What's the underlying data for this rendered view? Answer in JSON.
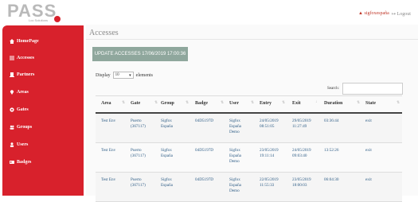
{
  "header": {
    "logo": "PASS",
    "logo_sub": "Loc Solutions",
    "user": "sigfoxespaña",
    "logout": "Logout"
  },
  "sidebar": {
    "items": [
      {
        "label": "HomePage",
        "icon": "home-icon"
      },
      {
        "label": "Accesses",
        "icon": "list-icon"
      },
      {
        "label": "Partners",
        "icon": "building-icon"
      },
      {
        "label": "Areas",
        "icon": "location-pin-icon"
      },
      {
        "label": "Gates",
        "icon": "gear-icon"
      },
      {
        "label": "Groups",
        "icon": "group-icon"
      },
      {
        "label": "Users",
        "icon": "user-icon"
      },
      {
        "label": "Badges",
        "icon": "id-card-icon"
      }
    ]
  },
  "main": {
    "title": "Accesses",
    "update_button": "UPDATE ACCESSES 17/06/2019 17:00:36",
    "display_label": "Display",
    "display_value": "10",
    "display_suffix": "elements",
    "search_label": "Search:"
  },
  "table": {
    "columns": [
      "Area",
      "Gate",
      "Group",
      "Badge",
      "User",
      "Entry",
      "Exit",
      "Duration",
      "State"
    ],
    "rows": [
      {
        "area": "Test Env",
        "gate": [
          "Puerto",
          "(367117)"
        ],
        "group": [
          "Sigfox",
          "España"
        ],
        "badge": "04D5197D",
        "user": [
          "Sigfox",
          "España",
          "Demo"
        ],
        "entry": [
          "24/05/2019",
          "08:51:05"
        ],
        "exit": [
          "29/05/2019",
          "11:27:49"
        ],
        "duration": "03:36:44",
        "state": "exit"
      },
      {
        "area": "Test Env",
        "gate": [
          "Puerto",
          "(367117)"
        ],
        "group": [
          "Sigfox",
          "España"
        ],
        "badge": "04D5197D",
        "user": [
          "Sigfox",
          "España",
          "Demo"
        ],
        "entry": [
          "23/05/2019",
          "19:11:14"
        ],
        "exit": [
          "24/05/2019",
          "09:03:40"
        ],
        "duration": "13:52:26",
        "state": "exit"
      },
      {
        "area": "Test Env",
        "gate": [
          "Puerto",
          "(367117)"
        ],
        "group": [
          "Sigfox",
          "España"
        ],
        "badge": "04D5197D",
        "user": [
          "Sigfox",
          "España",
          "Demo"
        ],
        "entry": [
          "22/05/2019",
          "11:55:33"
        ],
        "exit": [
          "23/05/2019",
          "18:00:03"
        ],
        "duration": "06:04:30",
        "state": "exit"
      }
    ]
  },
  "colors": {
    "sidebar": "#d8212c",
    "update_button": "#8fa79d",
    "link": "#2e5d86"
  }
}
